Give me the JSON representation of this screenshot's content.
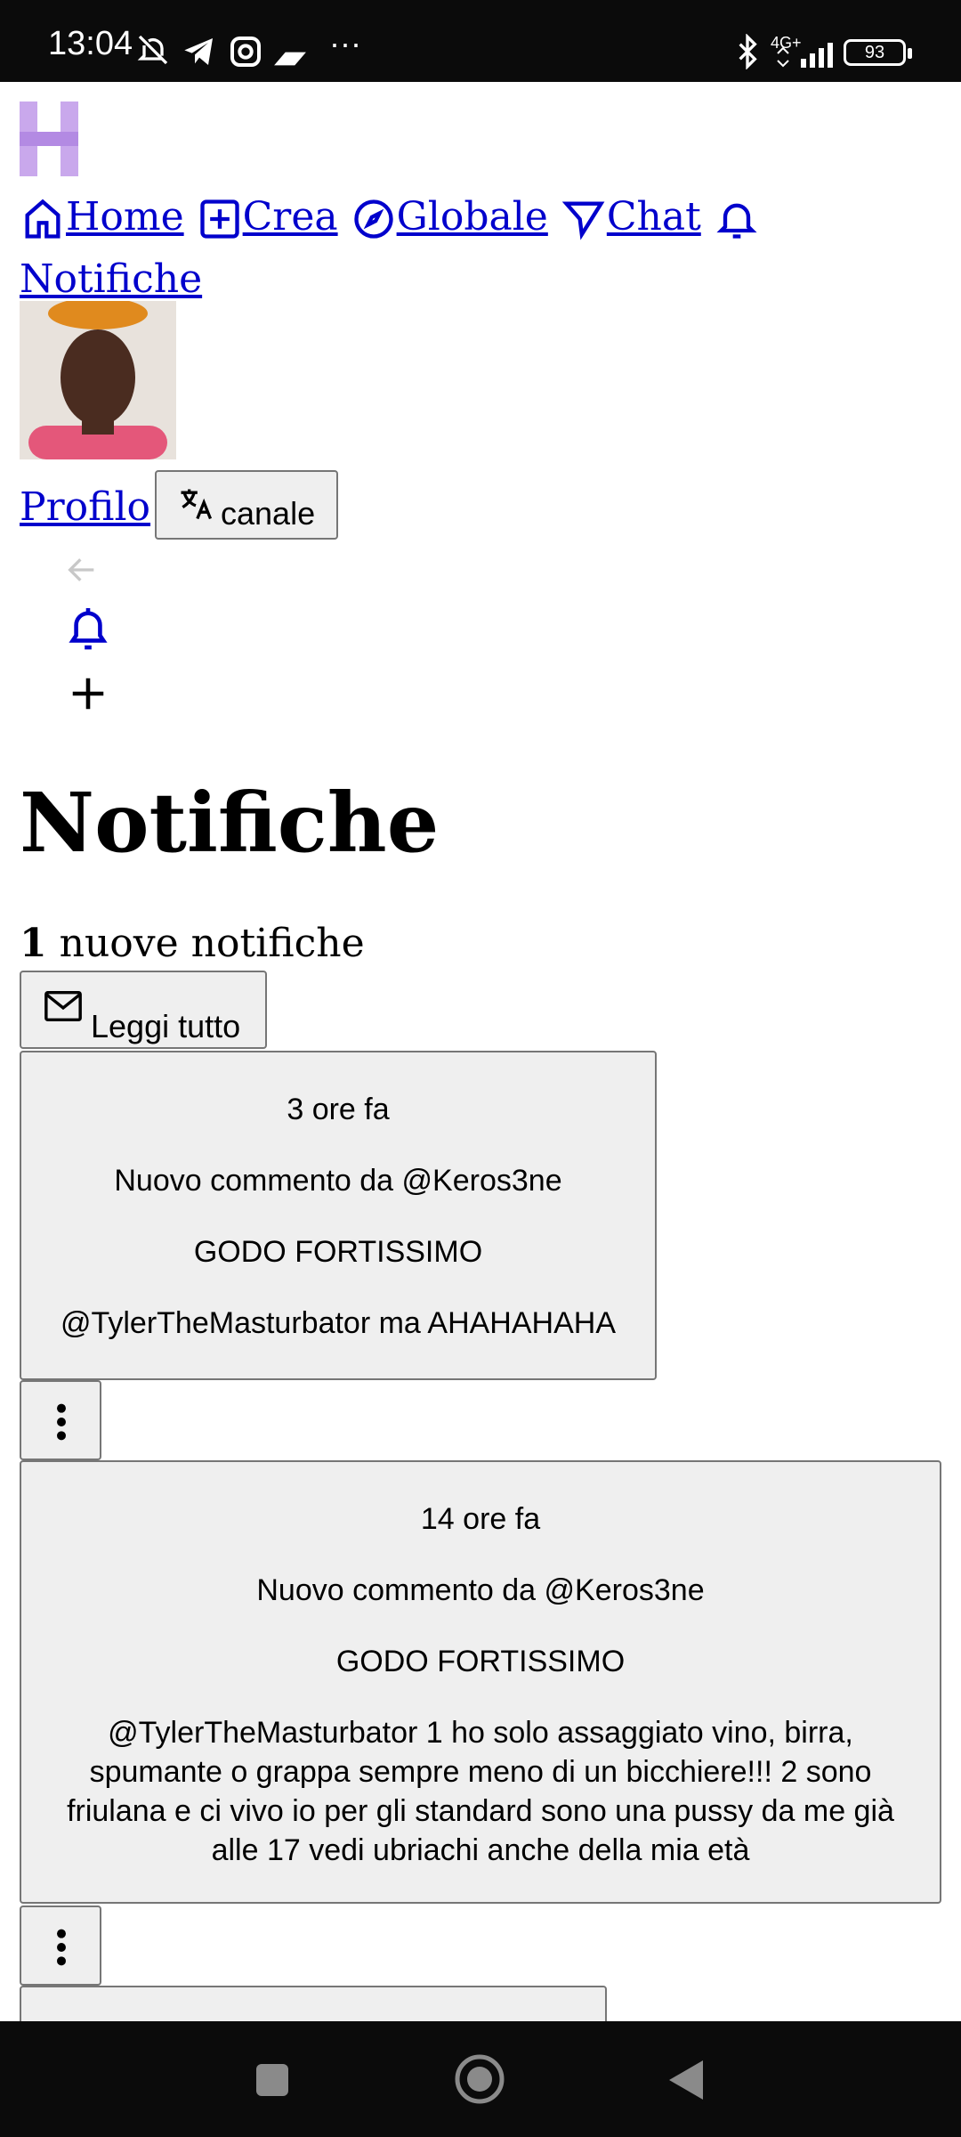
{
  "status_bar": {
    "time": "13:04",
    "network": "4G+",
    "battery": "93"
  },
  "nav": {
    "home": "Home",
    "create": "Crea",
    "global": "Globale",
    "chat": "Chat",
    "notifications": "Notifiche",
    "profile": "Profilo"
  },
  "channel_button": {
    "label": "canale"
  },
  "page": {
    "title": "Notifiche",
    "new_count": "1",
    "new_text": "nuove notifiche",
    "read_all": "Leggi tutto"
  },
  "notifications": [
    {
      "time": "3 ore fa",
      "heading": "Nuovo commento da @Keros3ne",
      "post": "GODO FORTISSIMO",
      "body": "@TylerTheMasturbator ma AHAHAHAHA"
    },
    {
      "time": "14 ore fa",
      "heading": "Nuovo commento da @Keros3ne",
      "post": "GODO FORTISSIMO",
      "body": "@TylerTheMasturbator 1 ho solo assaggiato vino, birra, spumante o grappa sempre meno di un bicchiere!!! 2 sono friulana e ci vivo io per gli standard sono una pussy da me già alle 17 vedi ubriachi anche della mia età"
    }
  ],
  "colors": {
    "link": "#0000cc",
    "button_bg": "#efefef",
    "accent_logo": "#c9a8ec"
  }
}
